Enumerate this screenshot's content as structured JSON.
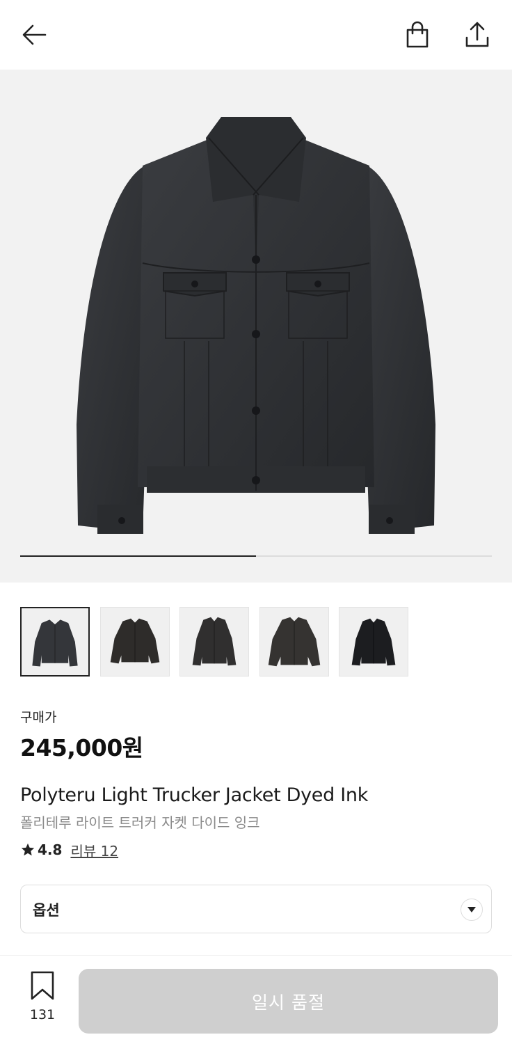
{
  "header": {
    "back_icon": "arrow-left-icon",
    "bag_icon": "shopping-bag-icon",
    "share_icon": "share-upload-icon"
  },
  "gallery": {
    "progress_fraction": 0.5,
    "thumbnail_count": 5,
    "active_thumbnail": 0
  },
  "product": {
    "price_label": "구매가",
    "price": "245,000원",
    "name_en": "Polyteru Light Trucker Jacket Dyed Ink",
    "name_ko": "폴리테루 라이트 트러커 자켓 다이드 잉크",
    "rating": "4.8",
    "review_label": "리뷰 12"
  },
  "option": {
    "label": "옵션"
  },
  "bottom": {
    "wish_count": "131",
    "cta_label": "일시 품절"
  },
  "colors": {
    "accent": "#222222",
    "disabled_button": "#cfcfcf",
    "hero_background": "#f2f2f2",
    "jacket": "#2f3134"
  }
}
